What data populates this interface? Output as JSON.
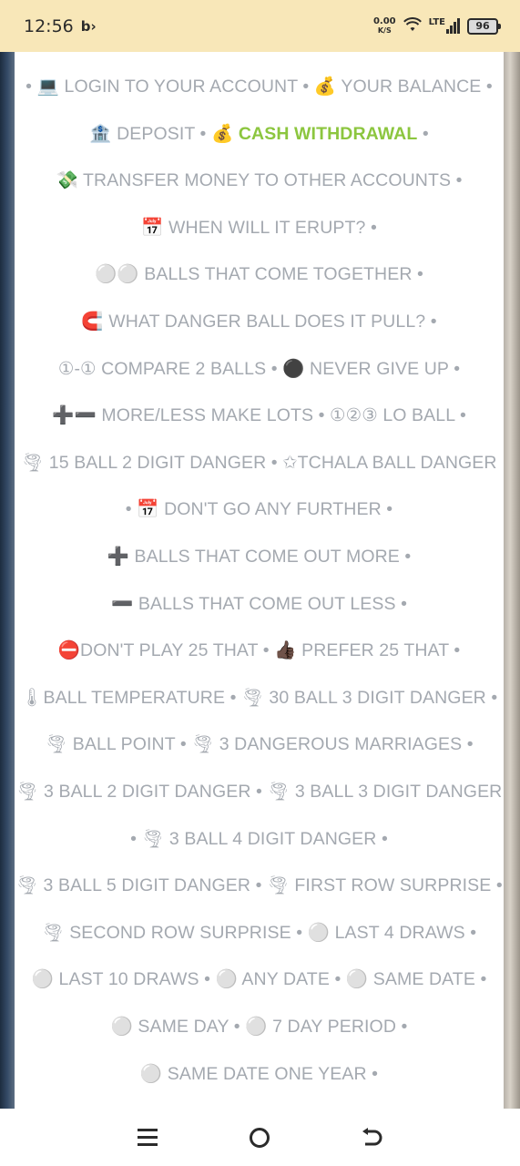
{
  "status_bar": {
    "time": "12:56",
    "app_icon": "b-arrow",
    "net_speed_value": "0.00",
    "net_speed_unit": "K/S",
    "network": "LTE",
    "battery": "96"
  },
  "menu": {
    "lines": [
      [
        {
          "text": "• 💻 LOGIN TO YOUR ACCOUNT • 💰 YOUR BALANCE •"
        }
      ],
      [
        {
          "text": "🏦 DEPOSIT • 💰 "
        },
        {
          "text": "CASH WITHDRAWAL",
          "highlight": true
        },
        {
          "text": " •"
        }
      ],
      [
        {
          "text": "💸 TRANSFER MONEY TO OTHER ACCOUNTS •"
        }
      ],
      [
        {
          "text": "📅 WHEN WILL IT ERUPT? •"
        }
      ],
      [
        {
          "text": "⚪⚪ BALLS THAT COME TOGETHER •"
        }
      ],
      [
        {
          "text": "🧲 WHAT DANGER BALL DOES IT PULL? •"
        }
      ],
      [
        {
          "text": "①-① COMPARE 2 BALLS • ⚫ NEVER GIVE UP •"
        }
      ],
      [
        {
          "text": "➕➖ MORE/LESS MAKE LOTS • ①②③ LO BALL •"
        }
      ],
      [
        {
          "text": "🌪 15 BALL 2 DIGIT DANGER • ✩TCHALA BALL DANGER"
        }
      ],
      [
        {
          "text": "• 📅 DON'T GO ANY FURTHER •"
        }
      ],
      [
        {
          "text": "➕ BALLS THAT COME OUT MORE •"
        }
      ],
      [
        {
          "text": "➖ BALLS THAT COME OUT LESS •"
        }
      ],
      [
        {
          "text": "⛔DON'T PLAY 25 THAT • 👍🏿 PREFER 25 THAT •"
        }
      ],
      [
        {
          "text": "🌡BALL TEMPERATURE • 🌪 30 BALL 3 DIGIT DANGER •"
        }
      ],
      [
        {
          "text": "🌪 BALL POINT • 🌪 3 DANGEROUS MARRIAGES •"
        }
      ],
      [
        {
          "text": "🌪 3 BALL 2 DIGIT DANGER • 🌪 3 BALL 3 DIGIT DANGER"
        }
      ],
      [
        {
          "text": "• 🌪 3 BALL 4 DIGIT DANGER •"
        }
      ],
      [
        {
          "text": "🌪 3 BALL 5 DIGIT DANGER • 🌪 FIRST ROW SURPRISE •"
        }
      ],
      [
        {
          "text": "🌪 SECOND ROW SURPRISE • ⚪ LAST 4 DRAWS •"
        }
      ],
      [
        {
          "text": "⚪ LAST 10 DRAWS • ⚪ ANY DATE • ⚪ SAME DATE •"
        }
      ],
      [
        {
          "text": "⚪ SAME DAY • ⚪ 7 DAY PERIOD •"
        }
      ],
      [
        {
          "text": "⚪ SAME DATE ONE YEAR •"
        }
      ]
    ]
  },
  "colors": {
    "text": "#a4a9b0",
    "highlight": "#8cc63f",
    "status_bar_bg": "#f8e7b8"
  }
}
